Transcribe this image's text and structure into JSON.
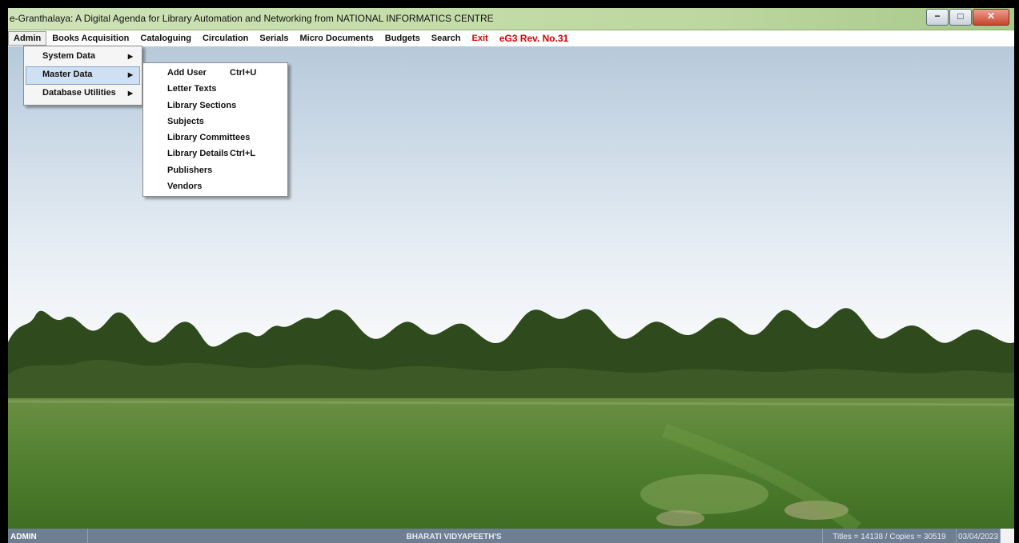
{
  "window": {
    "title": "e-Granthalaya: A Digital Agenda for Library Automation and Networking from NATIONAL INFORMATICS CENTRE",
    "controls": {
      "minimize": "minimize-icon",
      "maximize": "maximize-icon",
      "close": "close-icon"
    }
  },
  "menubar": {
    "items": [
      {
        "label": "Admin"
      },
      {
        "label": "Books Acquisition"
      },
      {
        "label": "Cataloguing"
      },
      {
        "label": "Circulation"
      },
      {
        "label": "Serials"
      },
      {
        "label": "Micro Documents"
      },
      {
        "label": "Budgets"
      },
      {
        "label": "Search"
      },
      {
        "label": "Exit"
      },
      {
        "label": "eG3 Rev. No.31"
      }
    ],
    "accent_red": "#d80000"
  },
  "admin_menu": {
    "items": [
      {
        "label": "System Data"
      },
      {
        "label": "Master Data"
      },
      {
        "label": "Database Utilities"
      }
    ]
  },
  "master_data_menu": {
    "items": [
      {
        "label": "Add User",
        "shortcut": "Ctrl+U"
      },
      {
        "label": "Letter Texts",
        "shortcut": ""
      },
      {
        "label": "Library Sections",
        "shortcut": ""
      },
      {
        "label": "Subjects",
        "shortcut": ""
      },
      {
        "label": "Library Committees",
        "shortcut": ""
      },
      {
        "label": "Library Details",
        "shortcut": "Ctrl+L"
      },
      {
        "label": "Publishers",
        "shortcut": ""
      },
      {
        "label": "Vendors",
        "shortcut": ""
      }
    ]
  },
  "statusbar": {
    "user": "ADMIN",
    "organization": "BHARATI VIDYAPEETH'S",
    "counts": "Titles = 14138 / Copies = 30519",
    "date": "03/04/2023"
  }
}
